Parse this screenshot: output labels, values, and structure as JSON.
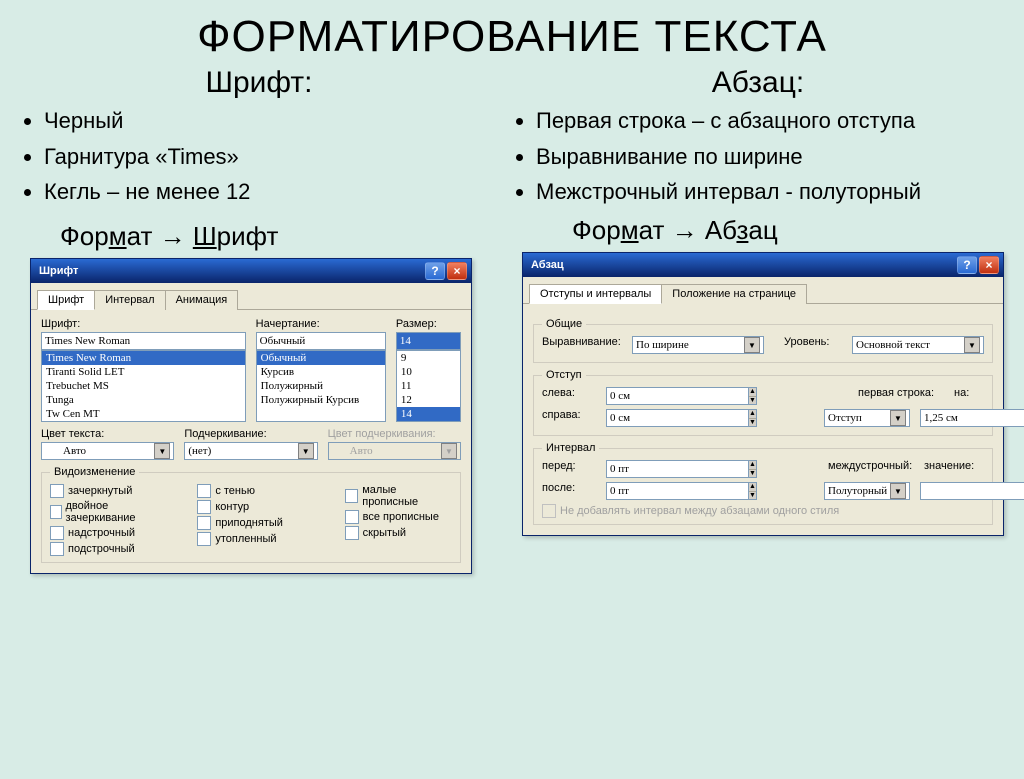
{
  "title": "ФОРМАТИРОВАНИЕ ТЕКСТА",
  "left": {
    "heading": "Шрифт:",
    "bullets": [
      "Черный",
      "Гарнитура «Times»",
      "Кегль – не менее 12"
    ],
    "menupath": {
      "m1": "Фор",
      "u1": "м",
      "m2": "ат",
      "arrow": " → ",
      "u2": "Ш",
      "m3": "рифт"
    }
  },
  "right": {
    "heading": "Абзац:",
    "bullets": [
      "Первая строка – с абзацного отступа",
      "Выравнивание по ширине",
      "Межстрочный интервал - полуторный"
    ],
    "menupath": {
      "m1": "Фор",
      "u1": "м",
      "m2": "ат",
      "arrow": " → ",
      "m3": "Аб",
      "u2": "з",
      "m4": "ац"
    }
  },
  "font_dialog": {
    "title": "Шрифт",
    "tabs": [
      "Шрифт",
      "Интервал",
      "Анимация"
    ],
    "labels": {
      "font": "Шрифт:",
      "style": "Начертание:",
      "size": "Размер:",
      "color": "Цвет текста:",
      "underline": "Подчеркивание:",
      "ulcolor": "Цвет подчеркивания:"
    },
    "font_value": "Times New Roman",
    "font_list": [
      "Times New Roman",
      "Tiranti Solid LET",
      "Trebuchet MS",
      "Tunga",
      "Tw Cen MT"
    ],
    "style_value": "Обычный",
    "style_list": [
      "Обычный",
      "Курсив",
      "Полужирный",
      "Полужирный Курсив"
    ],
    "size_value": "14",
    "size_list": [
      "9",
      "10",
      "11",
      "12",
      "14"
    ],
    "color_value": "Авто",
    "underline_value": "(нет)",
    "ulcolor_value": "Авто",
    "effects_legend": "Видоизменение",
    "effects_c1": [
      "зачеркнутый",
      "двойное зачеркивание",
      "надстрочный",
      "подстрочный"
    ],
    "effects_c2": [
      "с тенью",
      "контур",
      "приподнятый",
      "утопленный"
    ],
    "effects_c3": [
      "малые прописные",
      "все прописные",
      "скрытый"
    ]
  },
  "para_dialog": {
    "title": "Абзац",
    "tabs": [
      "Отступы и интервалы",
      "Положение на странице"
    ],
    "general_legend": "Общие",
    "labels": {
      "align": "Выравнивание:",
      "level": "Уровень:",
      "left": "слева:",
      "right": "справа:",
      "first": "первая строка:",
      "by": "на:",
      "before": "перед:",
      "after": "после:",
      "linespc": "междустрочный:",
      "val": "значение:"
    },
    "align_value": "По ширине",
    "level_value": "Основной текст",
    "indent_legend": "Отступ",
    "left_value": "0 см",
    "right_value": "0 см",
    "first_value": "Отступ",
    "by_value": "1,25 см",
    "spacing_legend": "Интервал",
    "before_value": "0 пт",
    "after_value": "0 пт",
    "linespc_value": "Полуторный",
    "val_value": "",
    "dont_add": "Не добавлять интервал между абзацами одного стиля"
  }
}
